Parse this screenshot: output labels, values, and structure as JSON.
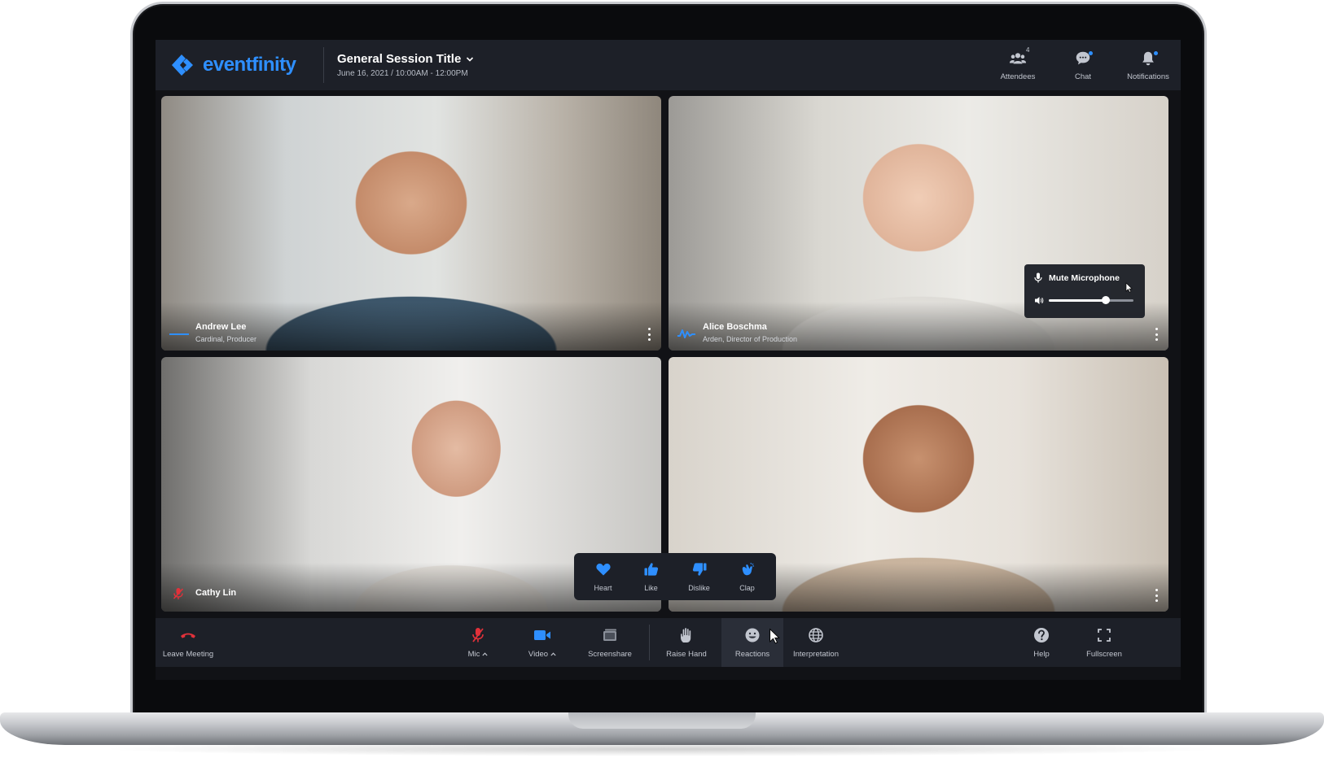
{
  "brand": {
    "name": "eventfinity",
    "color": "#2e8fff"
  },
  "header": {
    "session_title": "General Session Title",
    "session_date": "June 16, 2021 / 10:00AM - 12:00PM",
    "actions": [
      {
        "label": "Attendees",
        "icon": "attendees-icon",
        "badge": "4"
      },
      {
        "label": "Chat",
        "icon": "chat-icon"
      },
      {
        "label": "Notifications",
        "icon": "bell-icon"
      }
    ]
  },
  "participants": [
    {
      "name": "Andrew Lee",
      "role": "Cardinal, Producer",
      "status": "speaking-bar"
    },
    {
      "name": "Alice Boschma",
      "role": "Arden, Director of Production",
      "status": "speaking-wave"
    },
    {
      "name": "Cathy Lin",
      "role": "",
      "status": "muted"
    },
    {
      "name": "",
      "role": "",
      "status": "none"
    }
  ],
  "audio_popover": {
    "mute_label": "Mute Microphone",
    "volume_fraction": 0.67
  },
  "reactions": [
    {
      "label": "Heart",
      "icon": "heart-icon"
    },
    {
      "label": "Like",
      "icon": "thumbs-up-icon"
    },
    {
      "label": "Dislike",
      "icon": "thumbs-down-icon"
    },
    {
      "label": "Clap",
      "icon": "clap-icon"
    }
  ],
  "toolbar": {
    "leave": "Leave Meeting",
    "mic": "Mic",
    "video": "Video",
    "screenshare": "Screenshare",
    "raise_hand": "Raise Hand",
    "reactions": "Reactions",
    "interpretation": "Interpretation",
    "help": "Help",
    "fullscreen": "Fullscreen"
  },
  "colors": {
    "accent": "#2e8fff",
    "danger": "#e2313a",
    "bar_bg": "#1d2028"
  }
}
